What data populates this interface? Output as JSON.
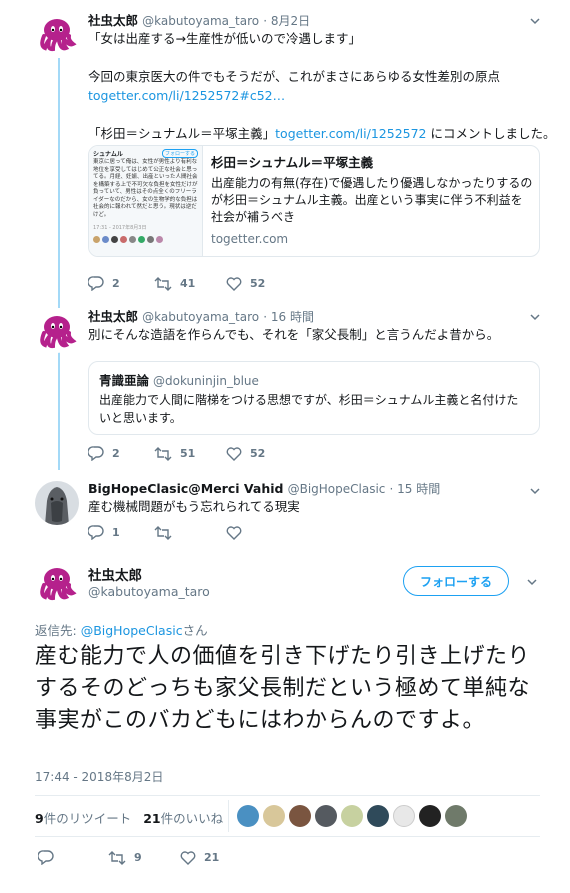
{
  "tweets": [
    {
      "name": "社虫太郎",
      "handle": "@kabutoyama_taro",
      "time": "· 8月2日",
      "line1": "「女は出産する→生産性が低いので冷遇します」",
      "line2": "今回の東京医大の件でもそうだが、これがまさにあらゆる女性差別の原点",
      "link1": "togetter.com/li/1252572#c52…",
      "line3_pre": "「杉田＝シュナムル＝平塚主義」",
      "line3_link": "togetter.com/li/1252572",
      "line3_post": " にコメントしました。",
      "card_title": "杉田＝シュナムル＝平塚主義",
      "card_desc": "出産能力の有無(存在)で優遇したり優遇しなかったりするのが杉田＝シュナムル主義。出産という事実に伴う不利益を社会が補うべき",
      "card_domain": "togetter.com",
      "card_thumb_title": "シュナムル",
      "card_thumb_text": "東京に居って俺は、女性が男性より有利な地位を享受してはじめて公正な社会と思ってる。月経、妊娠、出産といった人間社会を構築する上で不可欠な負担を女性だけが負っていて、男性はその点全くのフリーライダーなのだから、女の生物学的な負担は社会的に報われて然だと思う。現状は逆だけど。",
      "card_thumb_button": "フォローする",
      "card_thumb_time": "17:31 - 2017年8月3日",
      "replies": "2",
      "retweets": "41",
      "likes": "52"
    },
    {
      "name": "社虫太郎",
      "handle": "@kabutoyama_taro",
      "time": "· 16 時間",
      "text": "別にそんな造語を作らんでも、それを「家父長制」と言うんだよ昔から。",
      "quote_name": "青識亜論",
      "quote_handle": "@dokuninjin_blue",
      "quote_text": "出産能力で人間に階梯をつける思想ですが、杉田＝シュナムル主義と名付けたいと思います。",
      "replies": "2",
      "retweets": "51",
      "likes": "52"
    },
    {
      "name": "BigHopeClasic@Merci Vahid",
      "handle": "@BigHopeClasic",
      "time": "· 15 時間",
      "text": "産む機械問題がもう忘れられてる現実",
      "replies": "1"
    }
  ],
  "main": {
    "name": "社虫太郎",
    "handle": "@kabutoyama_taro",
    "follow_label": "フォローする",
    "reply_prefix": "返信先: ",
    "reply_to": "@BigHopeClasic",
    "reply_suffix": "さん",
    "text": "産む能力で人の価値を引き下げたり引き上げたりするそのどっちも家父長制だという極めて単純な事実がこのバカどもにはわからんのですよ。",
    "timestamp": "17:44 - 2018年8月2日",
    "rt_count": "9",
    "rt_label": "件のリツイート",
    "like_count": "21",
    "like_label": "件のいいね",
    "replies": "",
    "retweets": "9",
    "likes": "21"
  },
  "colors": {
    "accent": "#1da1f2",
    "link": "#1b95e0",
    "thread": "#a3d9f7",
    "muted": "#657786"
  },
  "icons": [
    "chevron-down-icon",
    "reply-icon",
    "retweet-icon",
    "like-icon",
    "octopus-avatar",
    "horse-avatar"
  ]
}
